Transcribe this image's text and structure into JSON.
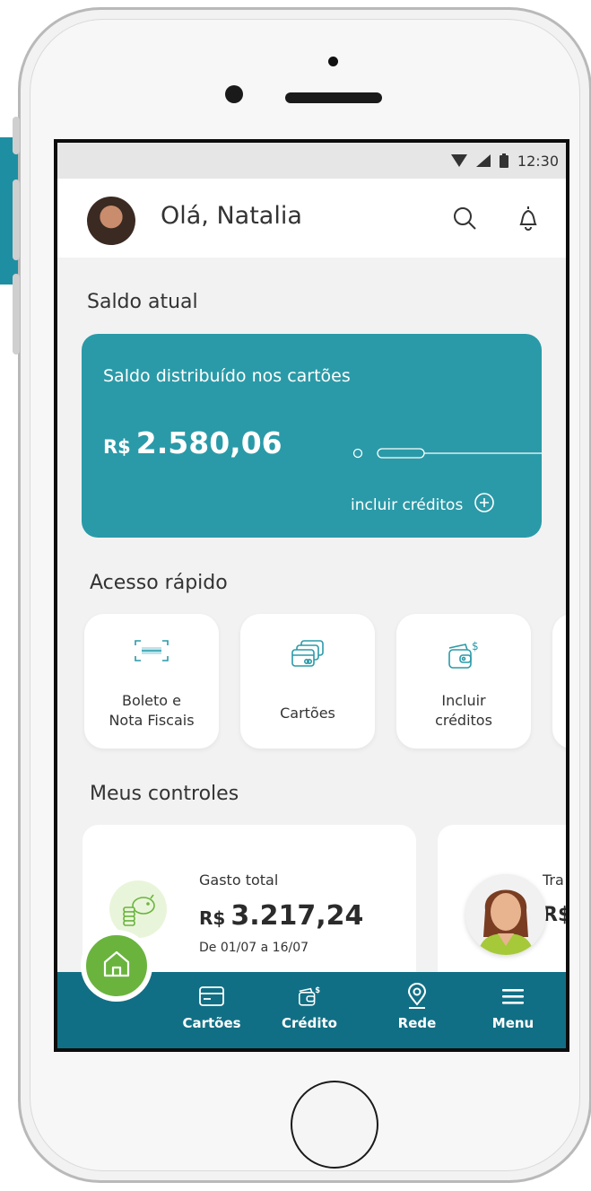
{
  "status_bar": {
    "time": "12:30"
  },
  "header": {
    "greeting": "Olá, Natalia"
  },
  "balance": {
    "section_title": "Saldo atual",
    "card_subtitle": "Saldo distribuído nos cartões",
    "currency": "R$",
    "amount": "2.580,06",
    "action_label": "incluir créditos"
  },
  "quick_access": {
    "section_title": "Acesso rápido",
    "items": [
      {
        "label": "Boleto e\nNota Fiscais",
        "icon": "barcode-scan-icon"
      },
      {
        "label": "Cartões",
        "icon": "cards-icon"
      },
      {
        "label": "Incluir\ncréditos",
        "icon": "wallet-dollar-icon"
      }
    ]
  },
  "controls": {
    "section_title": "Meus controles",
    "cards": [
      {
        "label": "Gasto total",
        "currency": "R$",
        "amount": "3.217,24",
        "date_range": "De 01/07 a 16/07",
        "icon": "piggy-bank-coins-icon"
      },
      {
        "label": "Tra",
        "currency": "R$"
      }
    ]
  },
  "bottom_nav": {
    "items": [
      {
        "label": "Cartões",
        "icon": "card-icon"
      },
      {
        "label": "Crédito",
        "icon": "wallet-dollar-icon"
      },
      {
        "label": "Rede",
        "icon": "map-pin-icon"
      },
      {
        "label": "Menu",
        "icon": "hamburger-icon"
      }
    ]
  },
  "colors": {
    "teal_card": "#2a9aa8",
    "nav_bar": "#116f85",
    "green_accent": "#6ab43e"
  }
}
